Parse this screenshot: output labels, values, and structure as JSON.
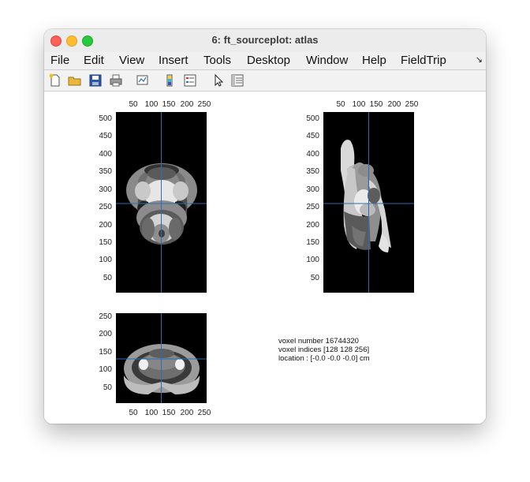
{
  "window": {
    "title": "6: ft_sourceplot: atlas"
  },
  "menu": {
    "items": [
      "File",
      "Edit",
      "View",
      "Insert",
      "Tools",
      "Desktop",
      "Window",
      "Help",
      "FieldTrip"
    ],
    "overflow_icon": "double-arrow-icon"
  },
  "toolbar": {
    "buttons": [
      "new-figure-icon",
      "open-file-icon",
      "save-icon",
      "print-icon",
      "link-plot-icon",
      "colorbar-icon",
      "legend-icon",
      "pointer-icon",
      "property-inspector-icon"
    ]
  },
  "axes": {
    "top_left": {
      "xticks": [
        "50",
        "100",
        "150",
        "200",
        "250"
      ],
      "yticks": [
        "500",
        "450",
        "400",
        "350",
        "300",
        "250",
        "200",
        "150",
        "100",
        "50"
      ]
    },
    "top_right": {
      "xticks": [
        "50",
        "100",
        "150",
        "200",
        "250"
      ],
      "yticks": [
        "500",
        "450",
        "400",
        "350",
        "300",
        "250",
        "200",
        "150",
        "100",
        "50"
      ]
    },
    "bottom_left": {
      "xticks": [
        "50",
        "100",
        "150",
        "200",
        "250"
      ],
      "yticks": [
        "250",
        "200",
        "150",
        "100",
        "50"
      ]
    }
  },
  "crosshair_color": "#2a6db5",
  "info": {
    "line1": "voxel number 16744320",
    "line2": "voxel indices [128 128 256]",
    "line3": "location : [-0.0 -0.0 -0.0] cm"
  }
}
